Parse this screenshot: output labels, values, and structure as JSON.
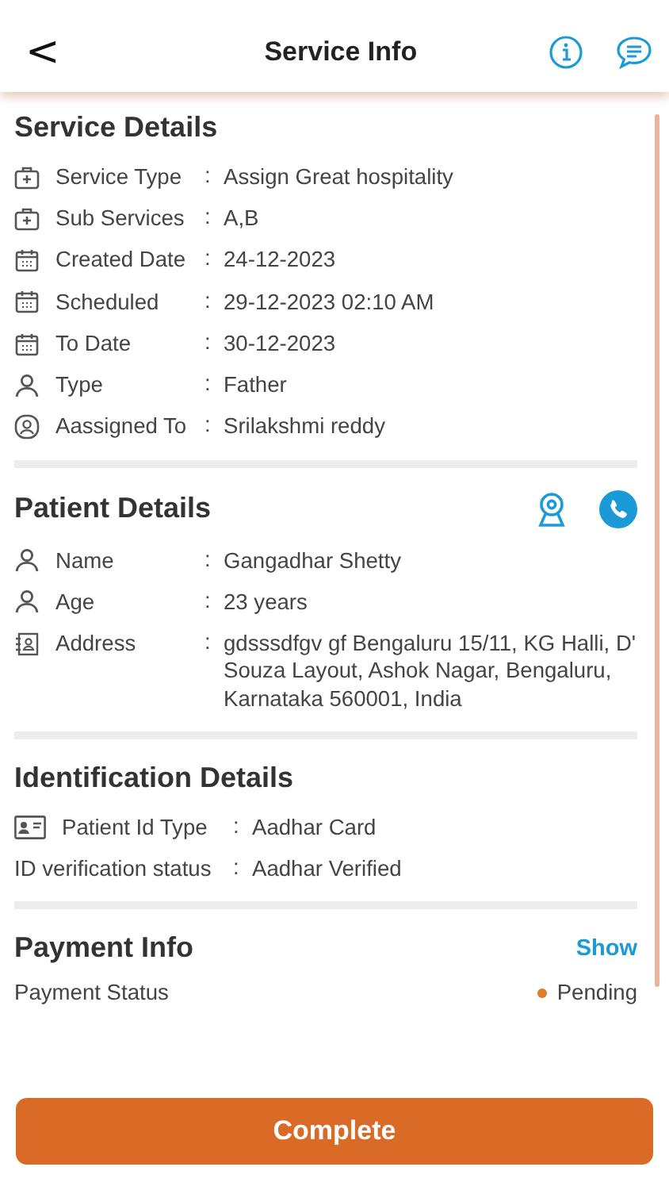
{
  "header": {
    "back": "<",
    "title": "Service Info"
  },
  "service_details": {
    "title": "Service Details",
    "rows": [
      {
        "kind": "medical",
        "label": "Service Type",
        "separator": ":",
        "value": "Assign Great hospitality"
      },
      {
        "kind": "medical",
        "label": "Sub Services",
        "separator": ":",
        "value": "A,B"
      },
      {
        "kind": "calendar",
        "label": "Created Date",
        "separator": ":",
        "value": "24-12-2023"
      },
      {
        "kind": "calendar",
        "label": "Scheduled",
        "separator": ":",
        "value": "29-12-2023 02:10 AM"
      },
      {
        "kind": "calendar",
        "label": "To Date",
        "separator": ":",
        "value": "30-12-2023"
      },
      {
        "kind": "person",
        "label": "Type",
        "separator": ":",
        "value": "Father"
      },
      {
        "kind": "person-circle",
        "label": "Aassigned To",
        "separator": ":",
        "value": "Srilakshmi reddy"
      }
    ]
  },
  "patient_details": {
    "title": "Patient Details",
    "rows": [
      {
        "kind": "person",
        "label": "Name",
        "separator": ":",
        "value": "Gangadhar Shetty"
      },
      {
        "kind": "person",
        "label": "Age",
        "separator": ":",
        "value": "23 years"
      },
      {
        "kind": "contact",
        "label": "Address",
        "separator": ":",
        "value": "gdsssdfgv gf Bengaluru 15/11, KG Halli, D' Souza Layout, Ashok Nagar, Bengaluru, Karnataka 560001, India"
      }
    ]
  },
  "identification_details": {
    "title": "Identification Details",
    "rows": [
      {
        "kind": "id-card",
        "label": "Patient Id Type",
        "separator": ":",
        "value": "Aadhar Card"
      },
      {
        "kind": "plain",
        "label": "ID verification status",
        "separator": ":",
        "value": "Aadhar Verified"
      }
    ]
  },
  "payment_info": {
    "title": "Payment Info",
    "toggle": "Show",
    "status_label": "Payment Status",
    "status": "Pending",
    "color": "#e07b2a"
  },
  "primary_button": "Complete"
}
